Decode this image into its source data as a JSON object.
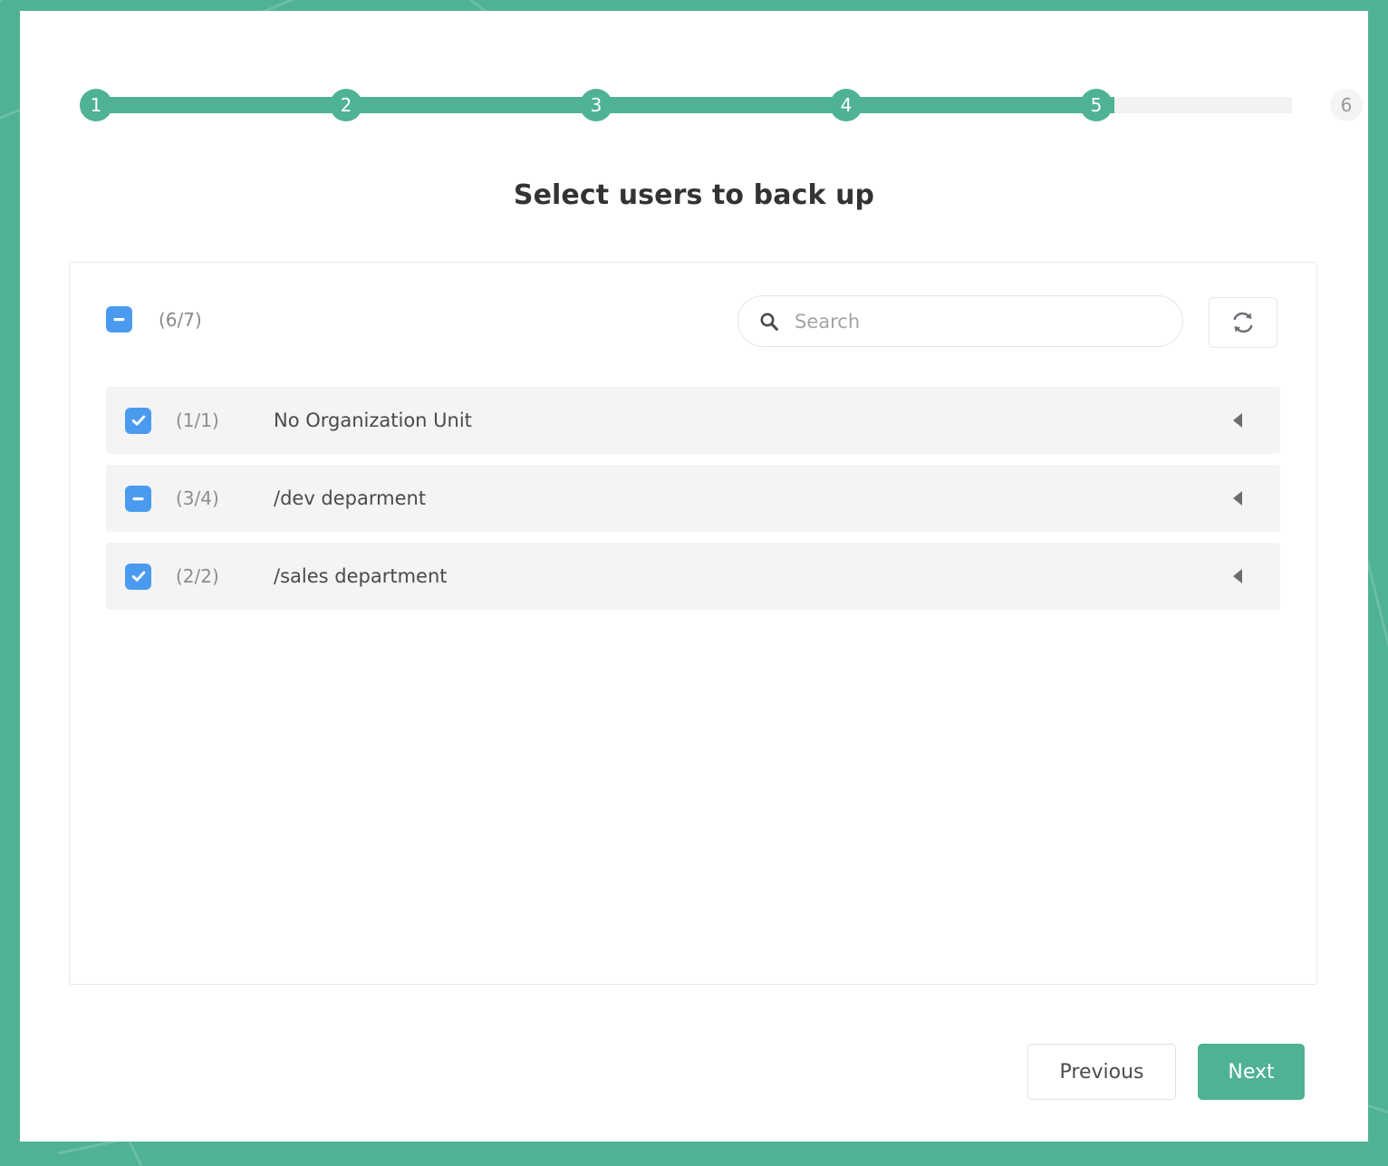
{
  "theme": {
    "accent_green": "#4fb294",
    "checkbox_blue": "#4a9bf0",
    "row_bg": "#f4f4f4",
    "inactive_gray": "#f4f4f4"
  },
  "stepper": {
    "current_step": 5,
    "total_steps": 6,
    "steps": [
      {
        "label": "1",
        "active": true
      },
      {
        "label": "2",
        "active": true
      },
      {
        "label": "3",
        "active": true
      },
      {
        "label": "4",
        "active": true
      },
      {
        "label": "5",
        "active": true
      },
      {
        "label": "6",
        "active": false
      }
    ]
  },
  "page": {
    "title": "Select users to back up"
  },
  "toolbar": {
    "master_checkbox_state": "indeterminate",
    "master_count": "(6/7)",
    "search_placeholder": "Search",
    "search_value": "",
    "search_icon": "search-icon",
    "refresh_icon": "refresh-icon"
  },
  "org_units": [
    {
      "checkbox_state": "checked",
      "count": "(1/1)",
      "name": "No Organization Unit",
      "caret": "caret-left-icon"
    },
    {
      "checkbox_state": "indeterminate",
      "count": "(3/4)",
      "name": "/dev deparment",
      "caret": "caret-left-icon"
    },
    {
      "checkbox_state": "checked",
      "count": "(2/2)",
      "name": "/sales department",
      "caret": "caret-left-icon"
    }
  ],
  "footer": {
    "previous_label": "Previous",
    "next_label": "Next"
  }
}
